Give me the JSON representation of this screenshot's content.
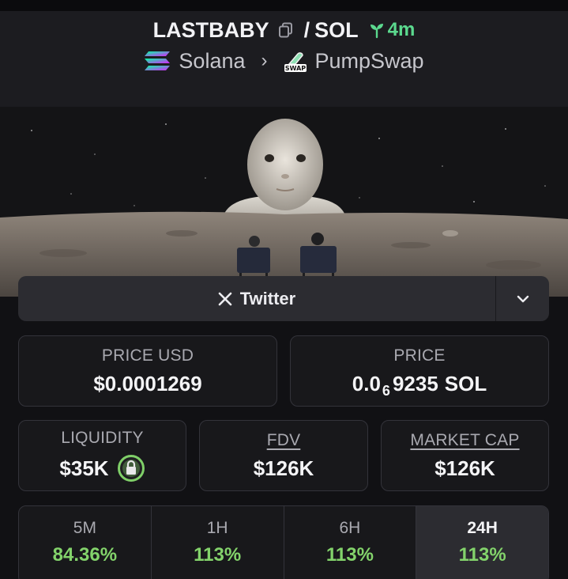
{
  "pair": {
    "base": "LASTBABY",
    "separator": "/",
    "quote": "SOL",
    "age": "4m"
  },
  "breadcrumb": {
    "chain": "Solana",
    "dex": "PumpSwap",
    "dex_icon_text": "SWAP"
  },
  "links": {
    "twitter_label": "Twitter"
  },
  "price_usd": {
    "label": "PRICE USD",
    "value": "$0.0001269"
  },
  "price": {
    "label": "PRICE",
    "prefix": "0.0",
    "zeros": "6",
    "digits": "9235",
    "unit": "SOL"
  },
  "liquidity": {
    "label": "LIQUIDITY",
    "value": "$35K"
  },
  "fdv": {
    "label": "FDV",
    "value": "$126K"
  },
  "market_cap": {
    "label": "MARKET CAP",
    "value": "$126K"
  },
  "timeframes": [
    {
      "label": "5M",
      "change": "84.36%"
    },
    {
      "label": "1H",
      "change": "113%"
    },
    {
      "label": "6H",
      "change": "113%"
    },
    {
      "label": "24H",
      "change": "113%"
    }
  ],
  "active_timeframe": "24H",
  "colors": {
    "positive": "#83d36b",
    "age": "#5bd98e",
    "background": "#111114",
    "panel": "#18181b"
  },
  "icons": [
    "copy-icon",
    "sprout-icon",
    "solana-icon",
    "chevron-right-icon",
    "pumpswap-icon",
    "x-icon",
    "chevron-down-icon",
    "lock-icon"
  ]
}
